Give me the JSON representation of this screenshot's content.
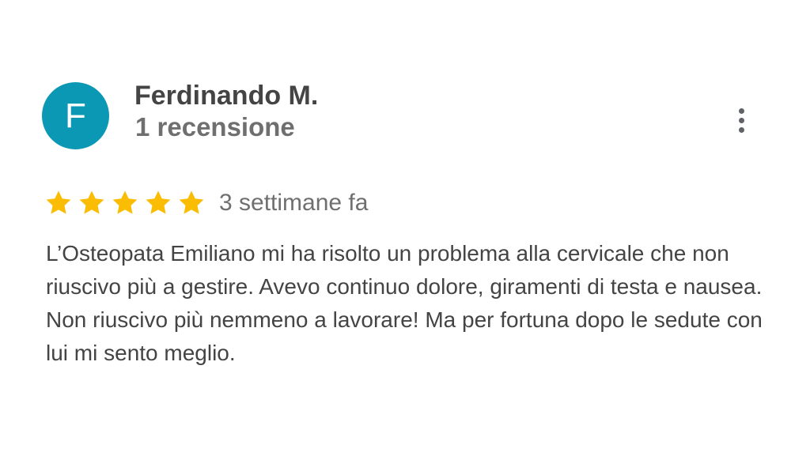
{
  "reviewer": {
    "initial": "F",
    "name": "Ferdinando M.",
    "review_count": "1 recensione",
    "avatar_color": "#0b98b5"
  },
  "menu": {
    "icon": "more-vert-icon"
  },
  "rating": {
    "stars": 5,
    "max_stars": 5,
    "star_color": "#fbbc04",
    "time_ago": "3 settimane fa"
  },
  "review": {
    "text": "L’Osteopata Emiliano mi ha risolto un problema alla cervicale che non riuscivo più a gestire. Avevo continuo dolore, giramenti di testa e nausea. Non riuscivo più nemmeno a lavorare! Ma per fortuna dopo le sedute con lui mi sento meglio."
  }
}
